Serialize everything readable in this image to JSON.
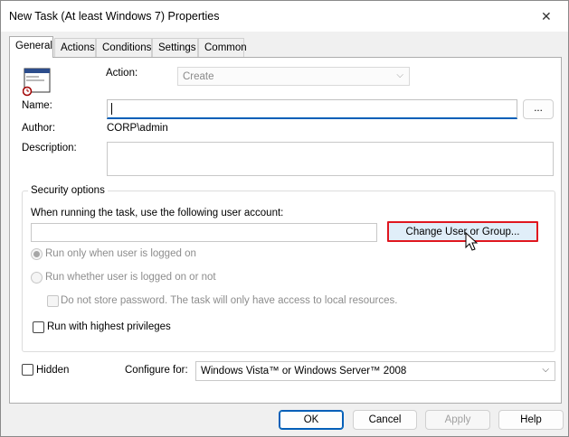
{
  "window": {
    "title": "New Task (At least Windows 7) Properties"
  },
  "tabs": [
    {
      "label": "General",
      "active": true
    },
    {
      "label": "Actions",
      "active": false
    },
    {
      "label": "Conditions",
      "active": false
    },
    {
      "label": "Settings",
      "active": false
    },
    {
      "label": "Common",
      "active": false
    }
  ],
  "general": {
    "action_label": "Action:",
    "action_value": "Create",
    "name_label": "Name:",
    "name_value": "",
    "browse_label": "...",
    "author_label": "Author:",
    "author_value": "CORP\\admin",
    "description_label": "Description:",
    "description_value": ""
  },
  "security": {
    "title": "Security options",
    "account_prompt": "When running the task, use the following user account:",
    "account_value": "",
    "change_button": "Change User or Group...",
    "radio_logged_on": "Run only when user is logged on",
    "radio_whether": "Run whether user is logged on or not",
    "no_store_password": "Do not store password. The task will only have access to local resources.",
    "highest_privileges": "Run with highest privileges"
  },
  "bottom": {
    "hidden_label": "Hidden",
    "configure_label": "Configure for:",
    "configure_value": "Windows Vista™ or Windows Server™ 2008"
  },
  "buttons": {
    "ok": "OK",
    "cancel": "Cancel",
    "apply": "Apply",
    "help": "Help"
  },
  "colors": {
    "accent": "#005fb8",
    "highlight_border": "#e0161f"
  }
}
